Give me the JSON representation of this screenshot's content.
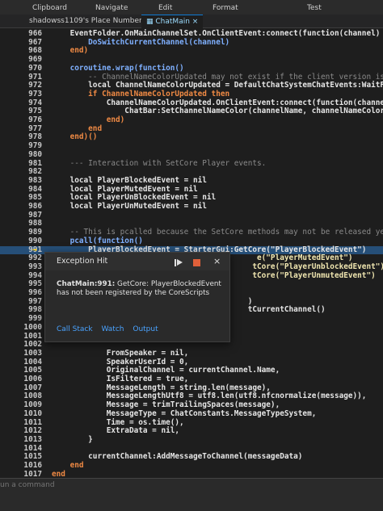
{
  "ribbon": {
    "items": [
      "Clipboard",
      "Navigate",
      "Edit",
      "Format",
      "Test"
    ]
  },
  "tabs": [
    {
      "label": "shadowss1109's Place Number: 6",
      "active": false
    },
    {
      "label": "ChatMain",
      "active": true
    }
  ],
  "code_lines": [
    {
      "n": "966",
      "t": "    EventFolder.OnMainChannelSet.OnClientEvent:connect(function(channel)",
      "cls": "v"
    },
    {
      "n": "967",
      "t": "        DoSwitchCurrentChannel(channel)",
      "cls": "f"
    },
    {
      "n": "968",
      "t": "    end)",
      "cls": "k"
    },
    {
      "n": "969",
      "t": "",
      "cls": "v"
    },
    {
      "n": "970",
      "t": "    coroutine.wrap(function()",
      "cls": "f"
    },
    {
      "n": "971",
      "t": "        -- ChannelNameColorUpdated may not exist if the client version is o",
      "cls": "c"
    },
    {
      "n": "972",
      "t": "        local ChannelNameColorUpdated = DefaultChatSystemChatEvents:WaitFor",
      "cls": "v"
    },
    {
      "n": "973",
      "t": "        if ChannelNameColorUpdated then",
      "cls": "k"
    },
    {
      "n": "974",
      "t": "            ChannelNameColorUpdated.OnClientEvent:connect(function(channelN",
      "cls": "v"
    },
    {
      "n": "975",
      "t": "                ChatBar:SetChannelNameColor(channelName, channelNameColor)",
      "cls": "v"
    },
    {
      "n": "976",
      "t": "            end)",
      "cls": "k"
    },
    {
      "n": "977",
      "t": "        end",
      "cls": "k"
    },
    {
      "n": "978",
      "t": "    end)()",
      "cls": "k"
    },
    {
      "n": "979",
      "t": "",
      "cls": "v"
    },
    {
      "n": "980",
      "t": "",
      "cls": "v"
    },
    {
      "n": "981",
      "t": "    --- Interaction with SetCore Player events.",
      "cls": "c"
    },
    {
      "n": "982",
      "t": "",
      "cls": "v"
    },
    {
      "n": "983",
      "t": "    local PlayerBlockedEvent = nil",
      "cls": "v"
    },
    {
      "n": "984",
      "t": "    local PlayerMutedEvent = nil",
      "cls": "v"
    },
    {
      "n": "985",
      "t": "    local PlayerUnBlockedEvent = nil",
      "cls": "v"
    },
    {
      "n": "986",
      "t": "    local PlayerUnMutedEvent = nil",
      "cls": "v"
    },
    {
      "n": "987",
      "t": "",
      "cls": "v"
    },
    {
      "n": "988",
      "t": "",
      "cls": "v"
    },
    {
      "n": "989",
      "t": "    -- This is pcalled because the SetCore methods may not be released yet.",
      "cls": "c"
    },
    {
      "n": "990",
      "t": "    pcall(function()",
      "cls": "f"
    },
    {
      "n": "991",
      "t": "        PlayerBlockedEvent = StarterGui:GetCore(\"PlayerBlockedEvent\")",
      "cls": "v",
      "hl": true
    },
    {
      "n": "992",
      "t": "                                             e(\"PlayerMutedEvent\")",
      "cls": "s"
    },
    {
      "n": "993",
      "t": "                                            tCore(\"PlayerUnblockedEvent\")",
      "cls": "s"
    },
    {
      "n": "994",
      "t": "                                            tCore(\"PlayerUnmutedEvent\")",
      "cls": "s"
    },
    {
      "n": "995",
      "t": "",
      "cls": "v"
    },
    {
      "n": "996",
      "t": "",
      "cls": "v"
    },
    {
      "n": "997",
      "t": "                                           )",
      "cls": "v"
    },
    {
      "n": "998",
      "t": "                                           tCurrentChannel()",
      "cls": "v"
    },
    {
      "n": "999",
      "t": "",
      "cls": "v"
    },
    {
      "n": "1000",
      "t": "",
      "cls": "v"
    },
    {
      "n": "1001",
      "t": "",
      "cls": "v"
    },
    {
      "n": "1002",
      "t": "",
      "cls": "v"
    },
    {
      "n": "1003",
      "t": "            FromSpeaker = nil,",
      "cls": "v"
    },
    {
      "n": "1004",
      "t": "            SpeakerUserId = 0,",
      "cls": "v"
    },
    {
      "n": "1005",
      "t": "            OriginalChannel = currentChannel.Name,",
      "cls": "v"
    },
    {
      "n": "1006",
      "t": "            IsFiltered = true,",
      "cls": "v"
    },
    {
      "n": "1007",
      "t": "            MessageLength = string.len(message),",
      "cls": "v"
    },
    {
      "n": "1008",
      "t": "            MessageLengthUtf8 = utf8.len(utf8.nfcnormalize(message)),",
      "cls": "v"
    },
    {
      "n": "1009",
      "t": "            Message = trimTrailingSpaces(message),",
      "cls": "v"
    },
    {
      "n": "1010",
      "t": "            MessageType = ChatConstants.MessageTypeSystem,",
      "cls": "v"
    },
    {
      "n": "1011",
      "t": "            Time = os.time(),",
      "cls": "v"
    },
    {
      "n": "1012",
      "t": "            ExtraData = nil,",
      "cls": "v"
    },
    {
      "n": "1013",
      "t": "        }",
      "cls": "v"
    },
    {
      "n": "1014",
      "t": "",
      "cls": "v"
    },
    {
      "n": "1015",
      "t": "        currentChannel:AddMessageToChannel(messageData)",
      "cls": "v"
    },
    {
      "n": "1016",
      "t": "    end",
      "cls": "k"
    },
    {
      "n": "1017",
      "t": "end",
      "cls": "k"
    }
  ],
  "exception": {
    "title": "Exception Hit",
    "message_bold": "ChatMain:991:",
    "message": " GetCore: PlayerBlockedEvent has not been registered by the CoreScripts",
    "links": [
      "Call Stack",
      "Watch",
      "Output"
    ]
  },
  "command_bar": {
    "placeholder": "un a command"
  },
  "colors": {
    "accent": "#0e7ad3",
    "stop_button": "#e0603a",
    "link": "#4aa3ff",
    "highlight": "#264f78"
  }
}
